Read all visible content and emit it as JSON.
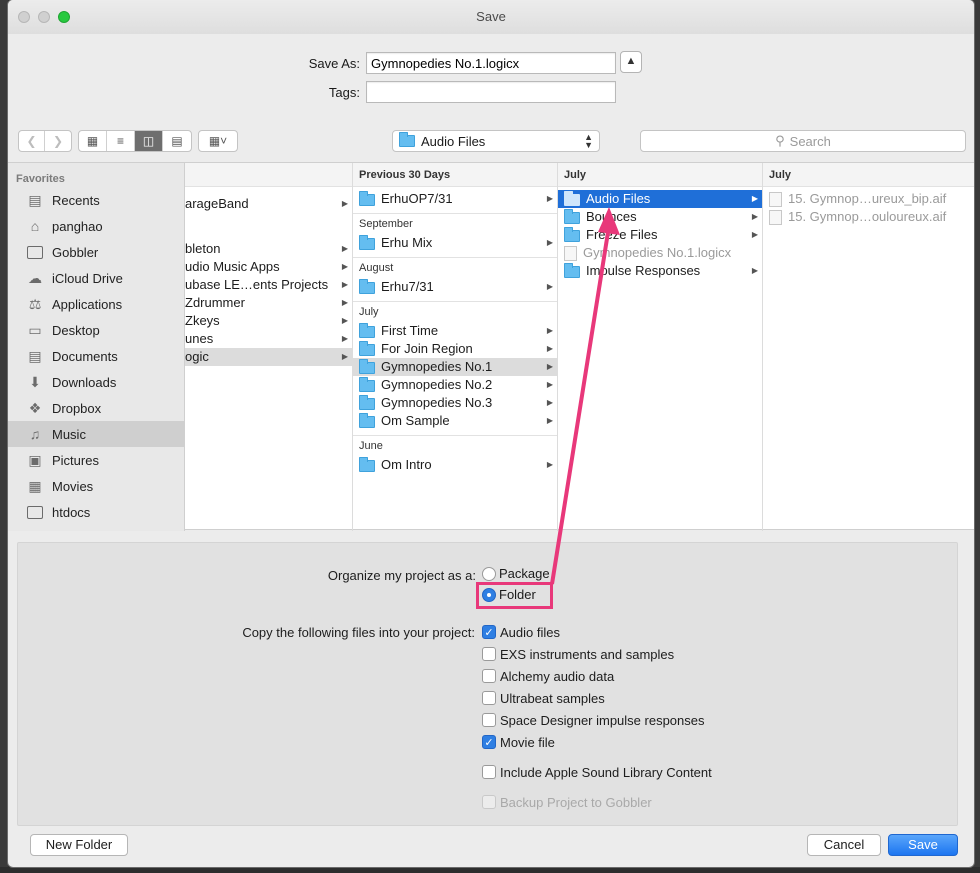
{
  "window": {
    "title": "Save"
  },
  "form": {
    "save_as_label": "Save As:",
    "save_as_value": "Gymnopedies No.1.logicx",
    "tags_label": "Tags:",
    "tags_value": "",
    "collapse_icon": "chevron-up"
  },
  "toolbar": {
    "location": "Audio Files",
    "search_placeholder": "Search"
  },
  "sidebar": {
    "header": "Favorites",
    "items": [
      {
        "label": "Recents",
        "icon": "recents-icon"
      },
      {
        "label": "panghao",
        "icon": "home-icon"
      },
      {
        "label": "Gobbler",
        "icon": "folder-icon"
      },
      {
        "label": "iCloud Drive",
        "icon": "cloud-icon"
      },
      {
        "label": "Applications",
        "icon": "applications-icon"
      },
      {
        "label": "Desktop",
        "icon": "desktop-icon"
      },
      {
        "label": "Documents",
        "icon": "documents-icon"
      },
      {
        "label": "Downloads",
        "icon": "downloads-icon"
      },
      {
        "label": "Dropbox",
        "icon": "dropbox-icon"
      },
      {
        "label": "Music",
        "icon": "music-icon"
      },
      {
        "label": "Pictures",
        "icon": "pictures-icon"
      },
      {
        "label": "Movies",
        "icon": "movies-icon"
      },
      {
        "label": "htdocs",
        "icon": "folder-icon"
      }
    ]
  },
  "columns": {
    "col1": {
      "header": "",
      "items": [
        "arageBand",
        "bleton",
        "udio Music Apps",
        "ubase LE…ents Projects",
        "Zdrummer",
        "Zkeys",
        "unes",
        "ogic"
      ]
    },
    "col2": {
      "header": "Previous 30 Days",
      "groups": [
        {
          "title": "",
          "items": [
            "ErhuOP7/31"
          ]
        },
        {
          "title": "September",
          "items": [
            "Erhu Mix"
          ]
        },
        {
          "title": "August",
          "items": [
            "Erhu7/31"
          ]
        },
        {
          "title": "July",
          "items": [
            "First Time",
            "For Join Region",
            "Gymnopedies No.1",
            "Gymnopedies No.2",
            "Gymnopedies No.3",
            "Om Sample"
          ]
        },
        {
          "title": "June",
          "items": [
            "Om Intro"
          ]
        }
      ]
    },
    "col3": {
      "header": "July",
      "items": [
        "Audio Files",
        "Bounces",
        "Freeze Files",
        "Gymnopedies No.1.logicx",
        "Impulse Responses"
      ]
    },
    "col4": {
      "header": "July",
      "items": [
        "15. Gymnop…ureux_bip.aif",
        "15. Gymnop…ouloureux.aif"
      ]
    }
  },
  "options": {
    "organize_label": "Organize my project as a:",
    "package_label": "Package",
    "folder_label": "Folder",
    "selected": "Folder",
    "copy_label": "Copy the following files into your project:",
    "checks": [
      {
        "label": "Audio files",
        "checked": true
      },
      {
        "label": "EXS instruments and samples",
        "checked": false
      },
      {
        "label": "Alchemy audio data",
        "checked": false
      },
      {
        "label": "Ultrabeat samples",
        "checked": false
      },
      {
        "label": "Space Designer impulse responses",
        "checked": false
      },
      {
        "label": "Movie file",
        "checked": true
      }
    ],
    "apple_sound_label": "Include Apple Sound Library Content",
    "backup_label": "Backup Project to Gobbler"
  },
  "buttons": {
    "new_folder": "New Folder",
    "cancel": "Cancel",
    "save": "Save"
  },
  "colors": {
    "accent": "#1f6fd8",
    "annotation": "#e8387a"
  }
}
